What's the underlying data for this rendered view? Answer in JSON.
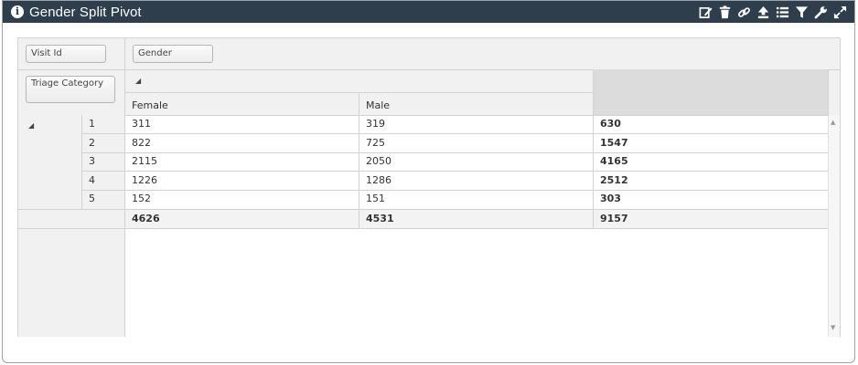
{
  "header": {
    "title": "Gender Split Pivot",
    "icons": [
      "edit-icon",
      "trash-icon",
      "link-icon",
      "upload-icon",
      "list-icon",
      "filter-icon",
      "wrench-icon",
      "expand-icon"
    ]
  },
  "pivot": {
    "fields": {
      "filter": "Visit Id",
      "column": "Gender",
      "row": "Triage Category"
    },
    "columns": [
      "Female",
      "Male"
    ],
    "rows": [
      {
        "category": "1",
        "female": "311",
        "male": "319",
        "total": "630"
      },
      {
        "category": "2",
        "female": "822",
        "male": "725",
        "total": "1547"
      },
      {
        "category": "3",
        "female": "2115",
        "male": "2050",
        "total": "4165"
      },
      {
        "category": "4",
        "female": "1226",
        "male": "1286",
        "total": "2512"
      },
      {
        "category": "5",
        "female": "152",
        "male": "151",
        "total": "303"
      }
    ],
    "grand_total": {
      "female": "4626",
      "male": "4531",
      "total": "9157"
    }
  }
}
